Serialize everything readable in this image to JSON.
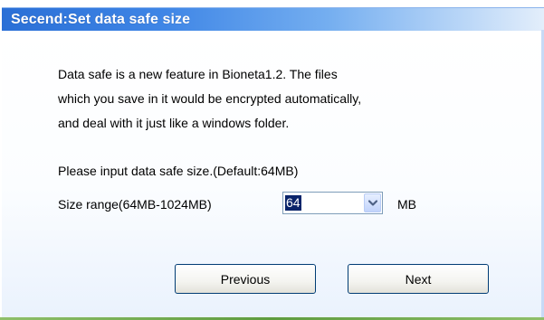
{
  "window": {
    "title": "Secend:Set data safe size"
  },
  "description": {
    "lines": [
      "Data safe is a new feature in Bioneta1.2. The files",
      "which you save in it would be encrypted automatically,",
      "and deal with it just like a windows folder."
    ]
  },
  "form": {
    "prompt": "Please input data safe size.(Default:64MB)",
    "range_label": "Size range(64MB-1024MB)",
    "size_value": "64",
    "unit": "MB"
  },
  "buttons": {
    "previous_label": "Previous",
    "next_label": "Next"
  },
  "icons": {
    "dropdown": "chevron-down-icon"
  },
  "colors": {
    "title_gradient_start": "#2a6fd6",
    "title_gradient_end": "#e3eefb",
    "selection": "#0a246a",
    "button_border": "#003c74"
  }
}
